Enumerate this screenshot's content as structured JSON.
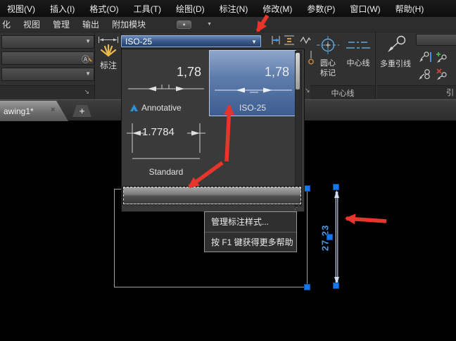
{
  "menubar": {
    "items": [
      {
        "label": "视图(V)"
      },
      {
        "label": "插入(I)"
      },
      {
        "label": "格式(O)"
      },
      {
        "label": "工具(T)"
      },
      {
        "label": "绘图(D)"
      },
      {
        "label": "标注(N)"
      },
      {
        "label": "修改(M)"
      },
      {
        "label": "参数(P)"
      },
      {
        "label": "窗口(W)"
      },
      {
        "label": "帮助(H)"
      }
    ]
  },
  "ribbon": {
    "tabs": [
      {
        "label": "化"
      },
      {
        "label": "视图"
      },
      {
        "label": "管理"
      },
      {
        "label": "输出"
      },
      {
        "label": "附加模块"
      }
    ]
  },
  "annotate": {
    "dim_button_label": "标注"
  },
  "style_combo": {
    "value": "ISO-25"
  },
  "flyout": {
    "items": [
      {
        "preview": "1,78",
        "label": "Annotative",
        "selected": false
      },
      {
        "preview": "1,78",
        "label": "ISO-25",
        "selected": true
      },
      {
        "preview": "1.7784",
        "label": "Standard",
        "selected": false
      }
    ]
  },
  "tooltip": {
    "line1": "管理标注样式...",
    "line2": "按 F1 键获得更多帮助"
  },
  "panels": {
    "centerline": {
      "buttons": [
        {
          "label": "圆心标记"
        },
        {
          "label": "中心线"
        }
      ],
      "title": "中心线"
    },
    "leader": {
      "button_label": "多重引线",
      "title": "引"
    }
  },
  "file_tabs": {
    "active": "awing1*"
  },
  "drawing": {
    "dimension_text": "27.23"
  },
  "icons": {
    "caret_down": "▼",
    "minimize_glyph": "▲",
    "close": "×",
    "new_tab": "+",
    "expander": "↘",
    "resize": "⋰"
  },
  "colors": {
    "selection_blue": "#3d5c90",
    "combo_blue": "#3c5c8c",
    "grip_blue": "#1478e8",
    "annotation_red": "#e8352b",
    "icon_blue": "#63a9db",
    "spark_yellow": "#e9ba4b",
    "dim_text_blue": "#4c98df"
  }
}
